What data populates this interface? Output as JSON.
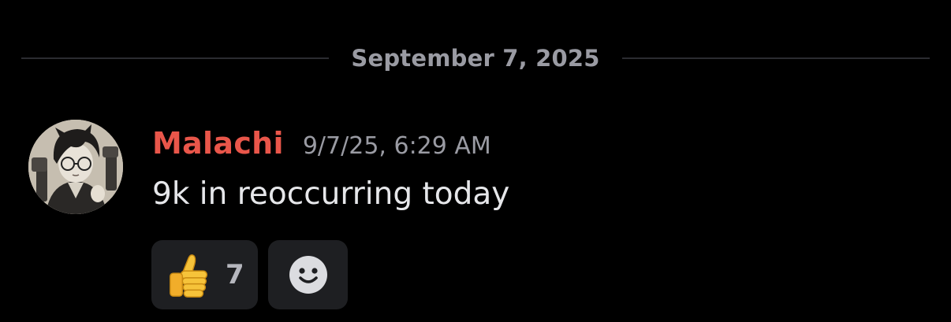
{
  "divider": {
    "date": "September 7, 2025"
  },
  "message": {
    "author": "Malachi",
    "author_color": "#e9564a",
    "timestamp": "9/7/25, 6:29 AM",
    "text": "9k in reoccurring today",
    "avatar_icon": "user-avatar-icon"
  },
  "reactions": [
    {
      "emoji": "thumbs-up-icon",
      "count": "7"
    },
    {
      "emoji": "add-reaction-smiley-icon"
    }
  ]
}
